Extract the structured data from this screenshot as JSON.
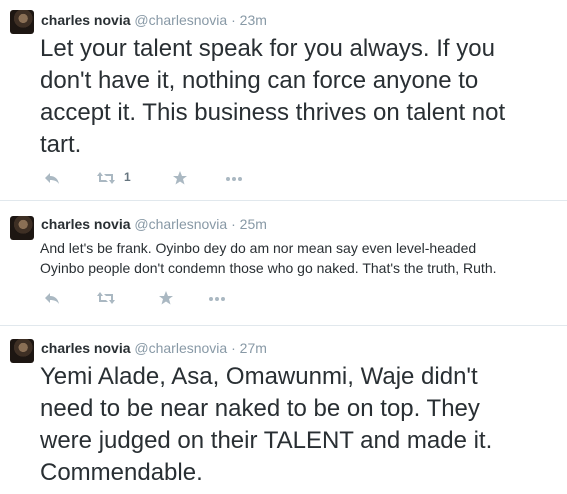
{
  "tweets": [
    {
      "name": "charles novia",
      "handle": "@charlesnovia",
      "time": "23m",
      "lines": [
        "Let your talent speak for you always. If you",
        "don't have it, nothing can force anyone to",
        "accept it. This business thrives on talent not",
        "tart."
      ],
      "retweet_count": "1"
    },
    {
      "name": "charles novia",
      "handle": "@charlesnovia",
      "time": "25m",
      "lines": [
        "And let's be frank.  Oyinbo dey do am nor mean say even level-headed",
        "Oyinbo people don't condemn those who go naked. That's the truth, Ruth."
      ],
      "retweet_count": ""
    },
    {
      "name": "charles novia",
      "handle": "@charlesnovia",
      "time": "27m",
      "lines": [
        "Yemi Alade, Asa, Omawunmi, Waje didn't",
        "need to be near naked to be on top. They",
        "were judged on their TALENT and made it.",
        "Commendable."
      ],
      "retweet_count": ""
    }
  ],
  "separator": " · ",
  "icons": [
    "reply-icon",
    "retweet-icon",
    "favorite-icon",
    "more-icon"
  ],
  "colors": {
    "text": "#292f33",
    "meta": "#8899a6",
    "action": "#aab8c2",
    "divider": "#e1e8ed"
  }
}
